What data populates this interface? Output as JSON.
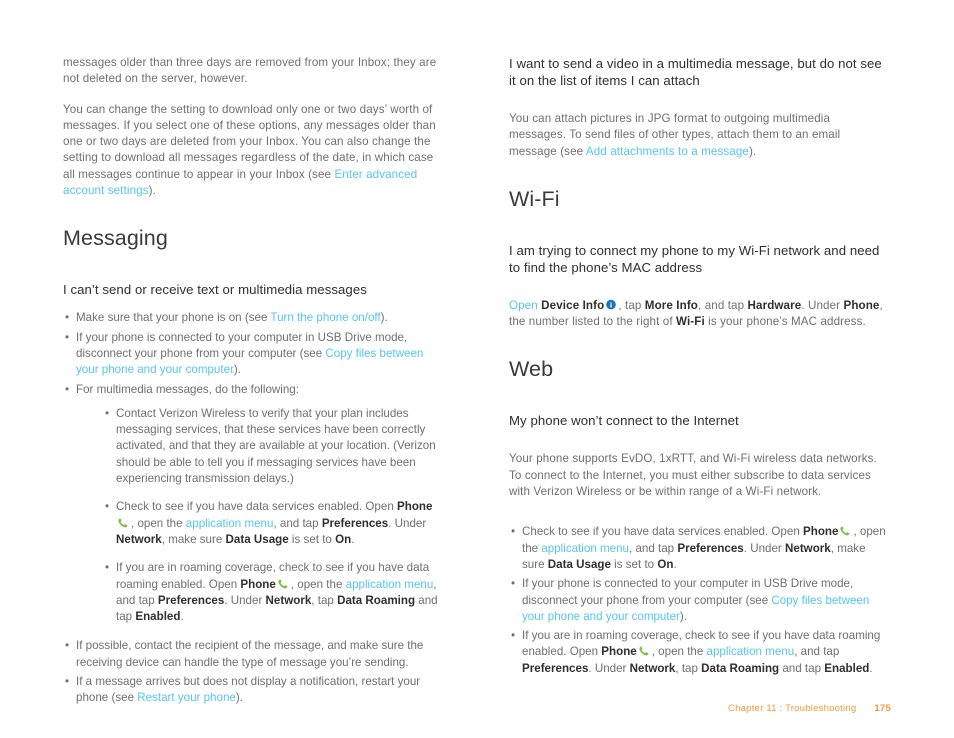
{
  "document": {
    "footer": {
      "chapter": "Chapter 11 : Troubleshooting",
      "page_number": "175"
    }
  },
  "colors": {
    "link": "#56c5ef",
    "body_text": "#6f6f6f",
    "heading": "#3a3a3a",
    "bold_text": "#2f2f2f",
    "footer": "#f49a3a",
    "phone_icon": "#7ac143",
    "info_icon": "#1b75bb"
  },
  "left_column": {
    "continued_paragraph_1": "messages older than three days are removed from your Inbox; they are not deleted on the server, however.",
    "paragraph_2": {
      "part1": "You can change the setting to download only one or two days’ worth of messages. If you select one of these options, any messages older than one or two days are deleted from your Inbox. You can also change the setting to download all messages regardless of the date, in which case all messages continue to appear in your Inbox (see ",
      "link1": "Enter advanced account settings",
      "part2": ")."
    },
    "section_heading": "Messaging",
    "subheading": "I can’t send or receive text or multimedia messages",
    "bullets": {
      "b1": {
        "part1": "Make sure that your phone is on (see ",
        "link1": "Turn the phone on/off",
        "part2": ")."
      },
      "b2": {
        "part1": "If your phone is connected to your computer in USB Drive mode, disconnect your phone from your computer (see ",
        "link1": "Copy files between your phone and your computer",
        "part2": ")."
      },
      "b3": {
        "text": "For multimedia messages, do the following:"
      },
      "b3_sub1": {
        "text": "Contact Verizon Wireless to verify that your plan includes messaging services, that these services have been correctly activated, and that they are available at your location. (Verizon should be able to tell you if messaging services have been experiencing transmission delays.)"
      },
      "b3_sub2": {
        "part1": "Check to see if you have data services enabled. Open ",
        "bold1": "Phone",
        "icon1": "phone-icon",
        "part2": ", open the ",
        "link1": "application menu",
        "part3": ", and tap ",
        "bold2": "Preferences",
        "part4": ". Under ",
        "bold3": "Network",
        "part5": ", make sure ",
        "bold4": "Data Usage",
        "part6": " is set to ",
        "bold5": "On",
        "part7": "."
      },
      "b3_sub3": {
        "part1": "If you are in roaming coverage, check to see if you have data roaming enabled. Open ",
        "bold1": "Phone",
        "icon1": "phone-icon",
        "part2": ", open the ",
        "link1": "application menu",
        "part3": ", and tap ",
        "bold2": "Preferences",
        "part4": ". Under ",
        "bold3": "Network",
        "part5": ", tap ",
        "bold4": "Data Roaming",
        "part6": " and tap ",
        "bold5": "Enabled",
        "part7": "."
      },
      "b4": {
        "text": "If possible, contact the recipient of the message, and make sure the receiving device can handle the type of message you’re sending."
      },
      "b5": {
        "part1": "If a message arrives but does not display a notification, restart your phone (see ",
        "link1": "Restart your phone",
        "part2": ")."
      }
    }
  },
  "right_column": {
    "subheading_1": "I want to send a video in a multimedia message, but do not see it on the list of items I can attach",
    "paragraph_1": {
      "part1": "You can attach pictures in JPG format to outgoing multimedia messages. To send files of other types, attach them to an email message (see ",
      "link1": "Add attachments to a message",
      "part2": ")."
    },
    "section_heading_wifi": "Wi-Fi",
    "subheading_2": "I am trying to connect my phone to my Wi-Fi network and need to find the phone’s MAC address",
    "paragraph_2": {
      "link1": "Open",
      "part1": " ",
      "bold1": "Device Info",
      "icon1": "info-icon",
      "part2": ", tap ",
      "bold2": "More Info",
      "part3": ", and tap ",
      "bold3": "Hardware",
      "part4": ". Under ",
      "bold4": "Phone",
      "part5": ", the number listed to the right of ",
      "bold5": "Wi-Fi",
      "part6": " is your phone’s MAC address."
    },
    "section_heading_web": "Web",
    "subheading_3": "My phone won’t connect to the Internet",
    "paragraph_3": "Your phone supports EvDO, 1xRTT, and Wi-Fi wireless data networks. To connect to the Internet, you must either subscribe to data services with Verizon Wireless or be within range of a Wi-Fi network.",
    "bullets": {
      "b1": {
        "part1": "Check to see if you have data services enabled. Open ",
        "bold1": "Phone",
        "icon1": "phone-icon",
        "part2": ", open the ",
        "link1": "application menu",
        "part3": ", and tap ",
        "bold2": "Preferences",
        "part4": ". Under ",
        "bold3": "Network",
        "part5": ", make sure ",
        "bold4": "Data Usage",
        "part6": " is set to ",
        "bold5": "On",
        "part7": "."
      },
      "b2": {
        "part1": "If your phone is connected to your computer in USB Drive mode, disconnect your phone from your computer (see ",
        "link1": "Copy files between your phone and your computer",
        "part2": ")."
      },
      "b3": {
        "part1": "If you are in roaming coverage, check to see if you have data roaming enabled. Open ",
        "bold1": "Phone",
        "icon1": "phone-icon",
        "part2": ", open the ",
        "link1": "application menu",
        "part3": ", and tap ",
        "bold2": "Preferences",
        "part4": ". Under ",
        "bold3": "Network",
        "part5": ", tap ",
        "bold4": "Data Roaming",
        "part6": " and tap ",
        "bold5": "Enabled",
        "part7": "."
      }
    }
  },
  "bullet_glyph": "•"
}
